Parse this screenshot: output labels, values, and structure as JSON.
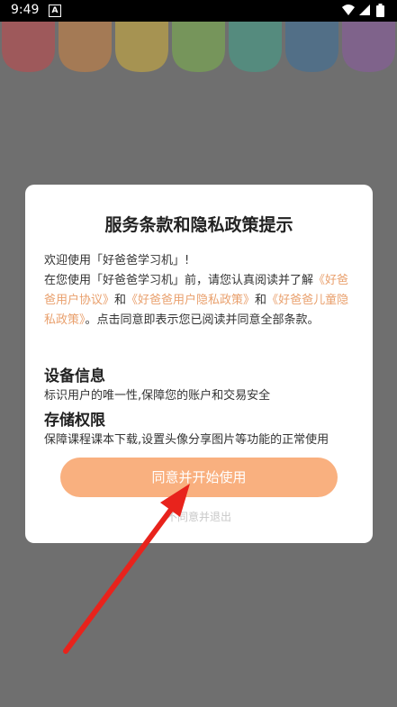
{
  "status_bar": {
    "time": "9:49",
    "notification_badge": "A",
    "icons": [
      "wifi-icon",
      "signal-icon",
      "battery-icon"
    ]
  },
  "awning_colors": [
    "#c4474b",
    "#cf8340",
    "#d3b13a",
    "#7bb54a",
    "#3fa28b",
    "#3a6f9a",
    "#8d5aa3"
  ],
  "dialog": {
    "title": "服务条款和隐私政策提示",
    "greeting": "欢迎使用「好爸爸学习机」!",
    "intro_prefix": "在您使用「好爸爸学习机」前，请您认真阅读并了解",
    "link_user_agreement": "《好爸爸用户协议》",
    "and_1": "和",
    "link_privacy_policy": "《好爸爸用户隐私政策》",
    "and_2": "和",
    "link_child_privacy": "《好爸爸儿童隐私政策》",
    "intro_suffix": "。点击同意即表示您已阅读并同意全部条款。",
    "sections": [
      {
        "heading": "设备信息",
        "text": "标识用户的唯一性,保障您的账户和交易安全"
      },
      {
        "heading": "存储权限",
        "text": "保障课程课本下载,设置头像分享图片等功能的正常使用"
      }
    ],
    "agree_button": "同意并开始使用",
    "decline_link": "不同意并退出"
  },
  "colors": {
    "accent": "#f9b07f",
    "link": "#e9a06d",
    "overlay": "#6f6f6f",
    "arrow": "#e8231c"
  }
}
